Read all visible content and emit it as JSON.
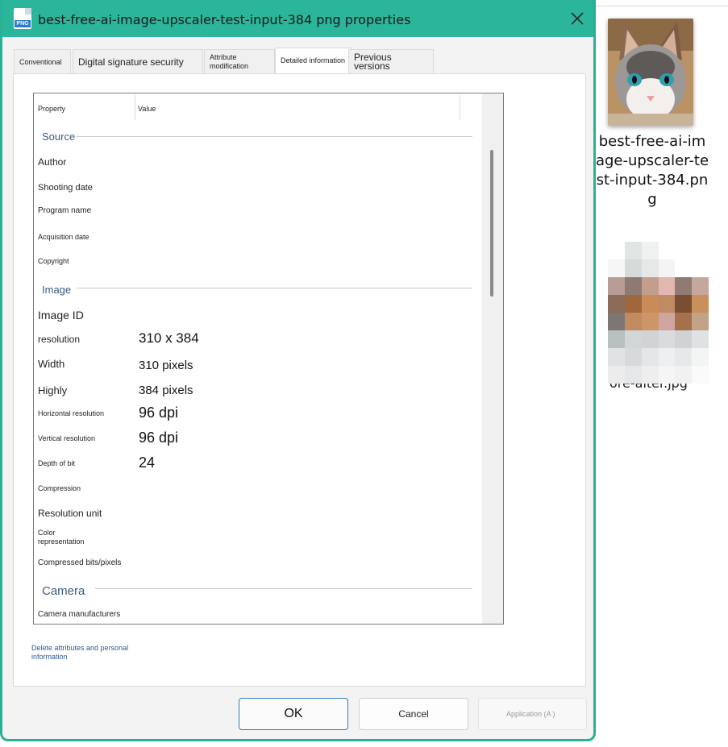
{
  "dialog": {
    "title": "best-free-ai-image-upscaler-test-input-384 png properties",
    "file_icon_tag": "PNG",
    "tabs": [
      {
        "label": "Conventional"
      },
      {
        "label": "Digital signature security"
      },
      {
        "label": "Attribute modification"
      },
      {
        "label": "Detailed information"
      },
      {
        "label": "Previous versions"
      }
    ],
    "columns": {
      "property": "Property",
      "value": "Value"
    },
    "groups": {
      "source": {
        "label": "Source",
        "rows": [
          {
            "label": "Author",
            "value": ""
          },
          {
            "label": "Shooting date",
            "value": ""
          },
          {
            "label": "Program name",
            "value": ""
          },
          {
            "label": "Acquisition date",
            "value": ""
          },
          {
            "label": "Copyright",
            "value": ""
          }
        ]
      },
      "image": {
        "label": "Image",
        "rows": [
          {
            "label": "Image ID",
            "value": ""
          },
          {
            "label": "resolution",
            "value": "310 x 384"
          },
          {
            "label": "Width",
            "value": "310 pixels"
          },
          {
            "label": "Highly",
            "value": "384 pixels"
          },
          {
            "label": "Horizontal resolution",
            "value": "96 dpi"
          },
          {
            "label": "Vertical resolution",
            "value": "96 dpi"
          },
          {
            "label": "Depth of bit",
            "value": "24"
          },
          {
            "label": "Compression",
            "value": ""
          },
          {
            "label": "Resolution unit",
            "value": ""
          },
          {
            "label": "Color representation",
            "value": ""
          },
          {
            "label": "Compressed bits/pixels",
            "value": ""
          }
        ]
      },
      "camera": {
        "label": "Camera",
        "rows": [
          {
            "label": "Camera manufacturers",
            "value": ""
          }
        ]
      }
    },
    "remove_link": "Delete attributes and personal information",
    "buttons": {
      "ok": "OK",
      "cancel": "Cancel",
      "apply": "Application (A )"
    }
  },
  "desktop": {
    "file_name": "best-free-ai-image-upscaler-test-input-384.png",
    "file_name_lines": [
      "best-free-ai-im",
      "age-upscaler-te",
      "st-input-384.pn",
      "g"
    ],
    "second_file_name_fragment": "ore-alter.jpg"
  },
  "colors": {
    "titlebar": "#2bb59b",
    "frame": "#27b196",
    "group_heading": "#3b5c80",
    "link": "#2c5a90",
    "ok_border": "#2e7fb8"
  },
  "icons": {
    "close": "close-icon",
    "file": "png-file-icon"
  }
}
